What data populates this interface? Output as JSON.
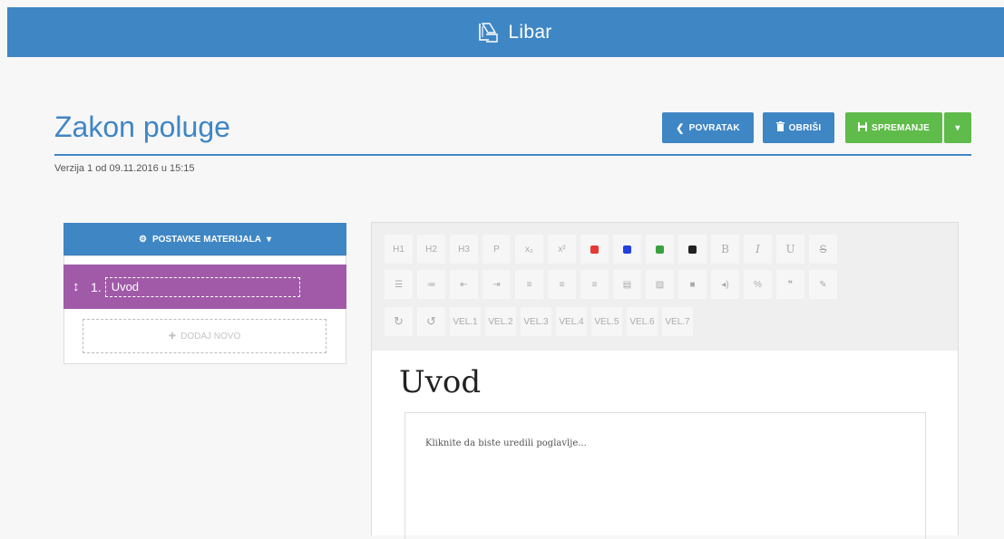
{
  "header": {
    "brand": "Libar"
  },
  "page": {
    "title": "Zakon poluge",
    "version": "Verzija 1 od 09.11.2016 u 15:15"
  },
  "actions": {
    "back_label": "POVRATAK",
    "delete_label": "OBRIŠI",
    "save_label": "SPREMANJE"
  },
  "sidebar": {
    "settings_label": "POSTAVKE MATERIJALA",
    "chapters": [
      {
        "number": "1.",
        "name": "Uvod"
      }
    ],
    "add_new_label": "DODAJ NOVO"
  },
  "toolbar": {
    "row1": [
      "H1",
      "H2",
      "H3",
      "P",
      "x₂",
      "x²"
    ],
    "row1_colors": [
      "#e53935",
      "#2340e0",
      "#3aa040",
      "#222222"
    ],
    "row1_format": [
      "B",
      "I",
      "U",
      "S"
    ],
    "row3_sizes": [
      "VEL.1",
      "VEL.2",
      "VEL.3",
      "VEL.4",
      "VEL.5",
      "VEL.6",
      "VEL.7"
    ]
  },
  "editor": {
    "heading": "Uvod",
    "placeholder": "Kliknite da biste uredili poglavlje..."
  },
  "colors": {
    "primary": "#3f86c4",
    "success": "#5fbb4a",
    "chapter": "#a05aa8"
  }
}
